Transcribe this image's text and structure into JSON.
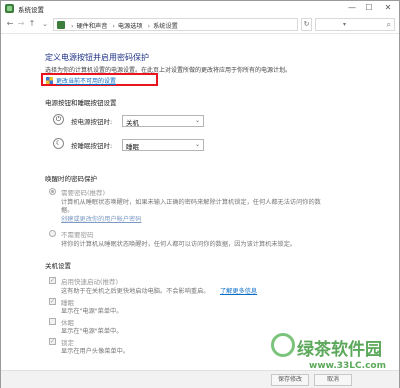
{
  "window": {
    "title": "系统设置",
    "controls": {
      "minimize": "—",
      "maximize": "☐",
      "close": "✕"
    }
  },
  "addressbar": {
    "crumbs": [
      "硬件和声音",
      "电源选项",
      "系统设置"
    ],
    "separator": "›",
    "search_placeholder": ""
  },
  "page": {
    "title": "定义电源按钮并启用密码保护",
    "description": "选择为你的计算机设置的电源设置。在此页上对设置所做的更改将应用于你所有的电源计划。",
    "change_link": "更改当前不可用的设置"
  },
  "power_buttons": {
    "section_title": "电源按钮和睡眠按钮设置",
    "rows": [
      {
        "label": "按电源按钮时:",
        "value": "关机"
      },
      {
        "label": "按睡眠按钮时:",
        "value": "睡眠"
      }
    ]
  },
  "password": {
    "section_title": "唤醒时的密码保护",
    "options": [
      {
        "label": "需要密码(推荐)",
        "desc_line1": "计算机从睡眠状态唤醒时，如果未输入正确的密码来解除计算机锁定，任何人都无法访问你的数",
        "desc_line2": "据。",
        "link": "创建或更改你的用户帐户密码",
        "checked": true
      },
      {
        "label": "不需要密码",
        "desc_line1": "将你的计算机从睡眠状态唤醒时，任何人都可以访问你的数据，因为该计算机未锁定。",
        "checked": false
      }
    ]
  },
  "shutdown": {
    "section_title": "关机设置",
    "items": [
      {
        "label": "启用快速启动(推荐)",
        "desc": "这有助于在关机之后更快地启动电脑。不会影响重启。",
        "link": "了解更多信息",
        "checked": true
      },
      {
        "label": "睡眠",
        "desc": "显示在\"电源\"菜单中。",
        "checked": true
      },
      {
        "label": "休眠",
        "desc": "显示在\"电源\"菜单中。",
        "checked": false
      },
      {
        "label": "锁定",
        "desc": "显示在用户头像菜单中。",
        "checked": true
      }
    ]
  },
  "footer": {
    "save": "保存修改",
    "cancel": "取消"
  },
  "watermark": {
    "text": "绿茶软件园",
    "url": "www.33LC.com"
  },
  "colors": {
    "title_blue": "#1e3287",
    "link_blue": "#0a6ec8",
    "highlight_red": "#e8141e",
    "watermark_green": "#3f9a3f"
  }
}
